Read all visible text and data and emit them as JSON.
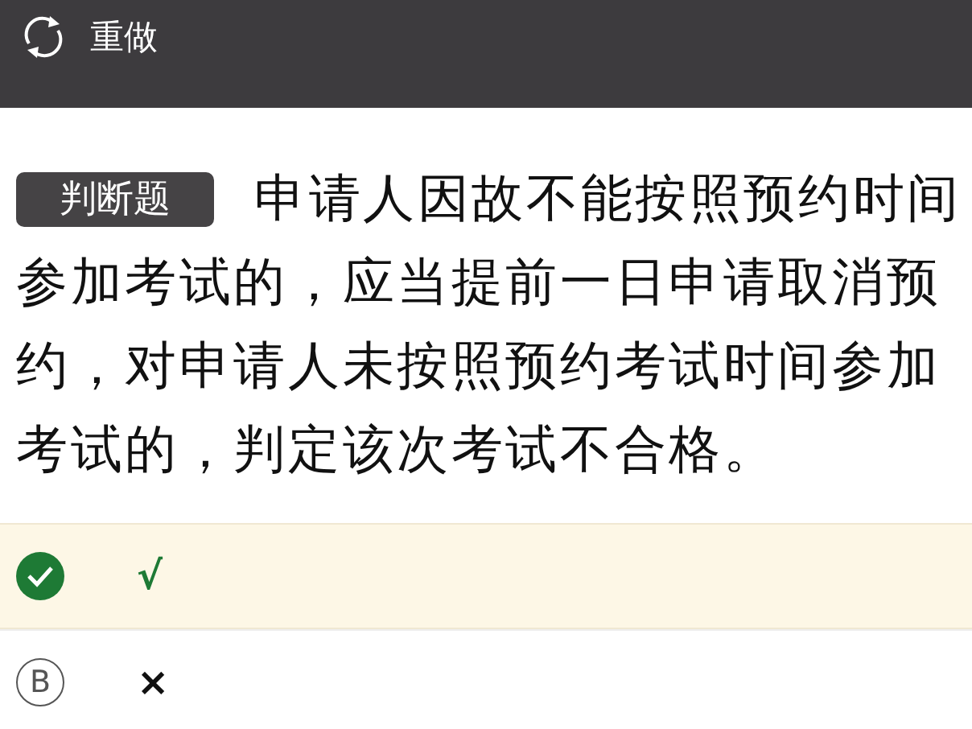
{
  "toolbar": {
    "redo_label": "重做"
  },
  "question": {
    "tag": "判断题",
    "text": "申请人因故不能按照预约时间参加考试的，应当提前一日申请取消预约，对申请人未按照预约考试时间参加考试的，判定该次考试不合格。"
  },
  "options": [
    {
      "text": "√",
      "selected": true
    },
    {
      "letter": "B",
      "text": "×",
      "selected": false
    }
  ]
}
